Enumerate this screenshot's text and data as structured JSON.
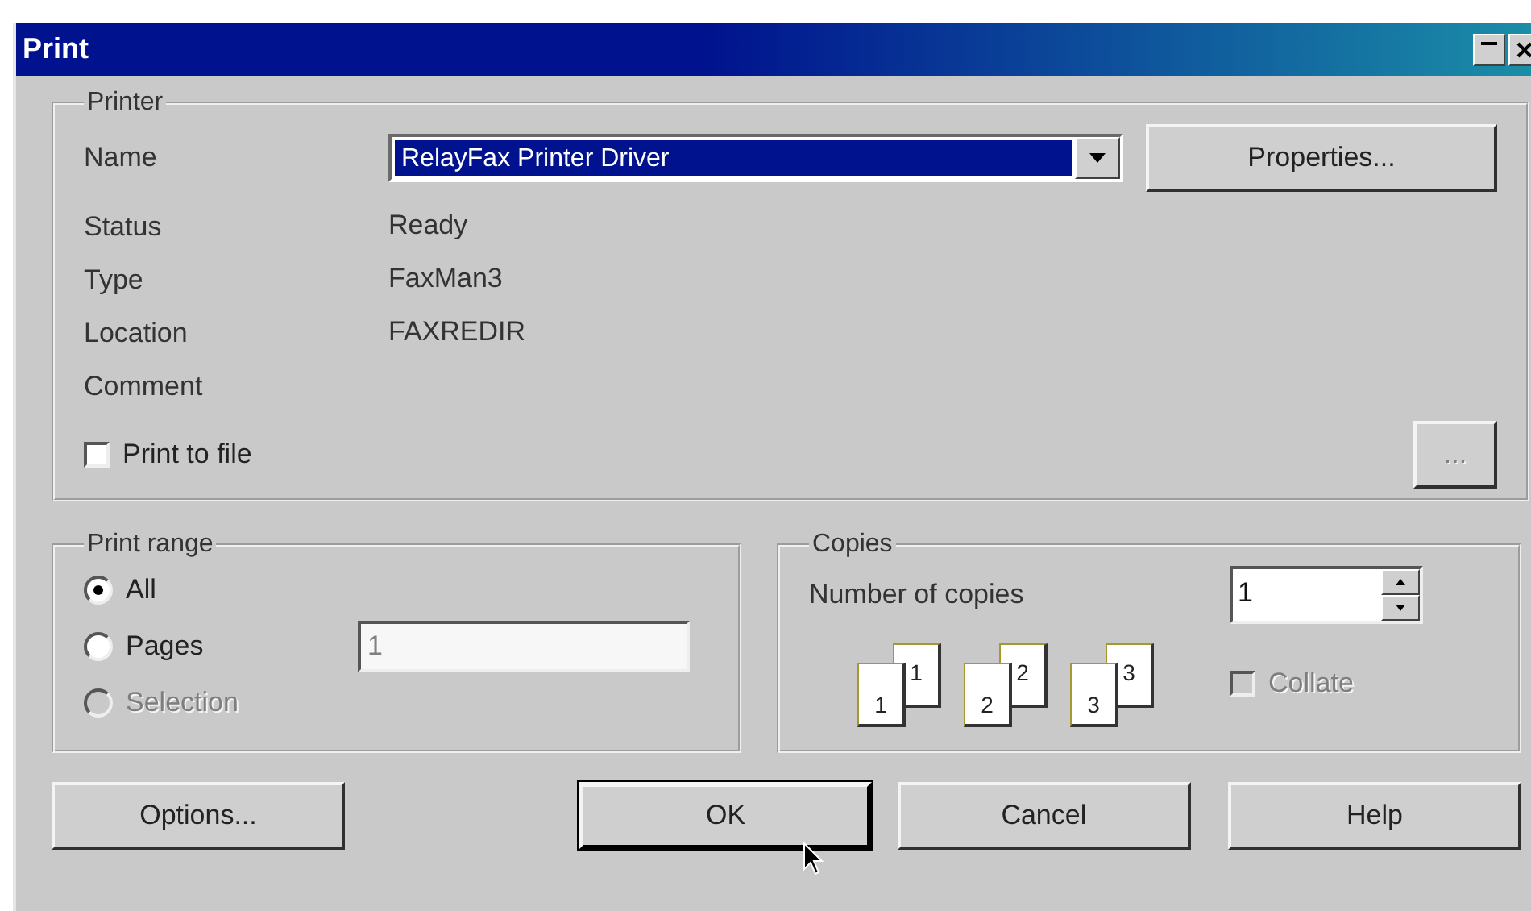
{
  "window": {
    "title": "Print"
  },
  "printer": {
    "label": "Printer",
    "name_label": "Name",
    "name_value": "RelayFax Printer Driver",
    "properties_button": "Properties...",
    "info": [
      {
        "label": "Status",
        "value": "Ready"
      },
      {
        "label": "Type",
        "value": "FaxMan3"
      },
      {
        "label": "Location",
        "value": "FAXREDIR"
      },
      {
        "label": "Comment"
      }
    ],
    "print_to_file": {
      "label": "Print to file",
      "checked": false
    },
    "browse_button": {
      "label": "...",
      "disabled": true
    }
  },
  "print_range": {
    "label": "Print range",
    "options": [
      {
        "label": "All",
        "selected": true,
        "disabled": false
      },
      {
        "label": "Pages",
        "selected": false,
        "disabled": false
      },
      {
        "label": "Selection",
        "selected": false,
        "disabled": true
      }
    ],
    "pages_field": {
      "value": "1",
      "disabled": true
    }
  },
  "copies": {
    "label": "Copies",
    "count_label": "Number of copies",
    "count_value": "1",
    "collate_pages": [
      {
        "front": "1",
        "back": "1"
      },
      {
        "front": "2",
        "back": "2"
      },
      {
        "front": "3",
        "back": "3"
      }
    ],
    "collate": {
      "label": "Collate",
      "checked": false,
      "disabled": true
    }
  },
  "buttons": [
    {
      "label": "Options...",
      "default": false
    },
    {
      "label": "OK",
      "default": true
    },
    {
      "label": "Cancel",
      "default": false
    },
    {
      "label": "Help",
      "default": false
    }
  ]
}
